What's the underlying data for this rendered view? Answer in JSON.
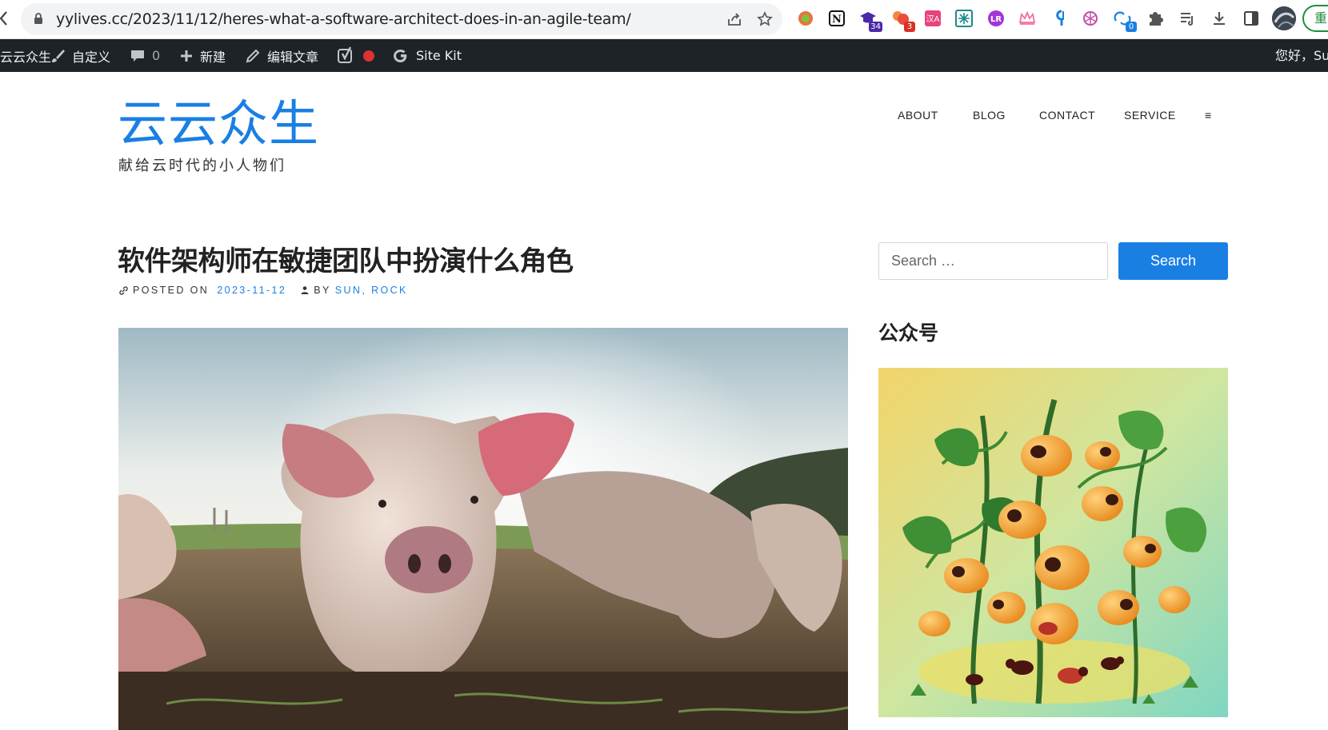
{
  "browser": {
    "url": "yylives.cc/2023/11/12/heres-what-a-software-architect-does-in-an-agile-team/",
    "extension_badges": {
      "mortarboard": "34",
      "cluster": "3",
      "sync": "0"
    },
    "profile_label": "重"
  },
  "admin_bar": {
    "site_name": "云云众生",
    "customize": "自定义",
    "comments_count": "0",
    "new": "新建",
    "edit_post": "编辑文章",
    "site_kit": "Site Kit",
    "greeting": "您好，Su"
  },
  "site": {
    "title": "云云众生",
    "description": "献给云时代的小人物们"
  },
  "nav": {
    "items": [
      "ABOUT",
      "BLOG",
      "CONTACT",
      "SERVICE"
    ],
    "more_icon": "≡"
  },
  "post": {
    "title": "软件架构师在敏捷团队中扮演什么角色",
    "posted_on_label": "POSTED ON",
    "date": "2023-11-12",
    "by_label": "BY",
    "author": "SUN, ROCK"
  },
  "sidebar": {
    "search_placeholder": "Search …",
    "search_button": "Search",
    "widget_title": "公众号"
  },
  "colors": {
    "accent": "#1a7fe3",
    "admin_bar": "#1d2327"
  }
}
